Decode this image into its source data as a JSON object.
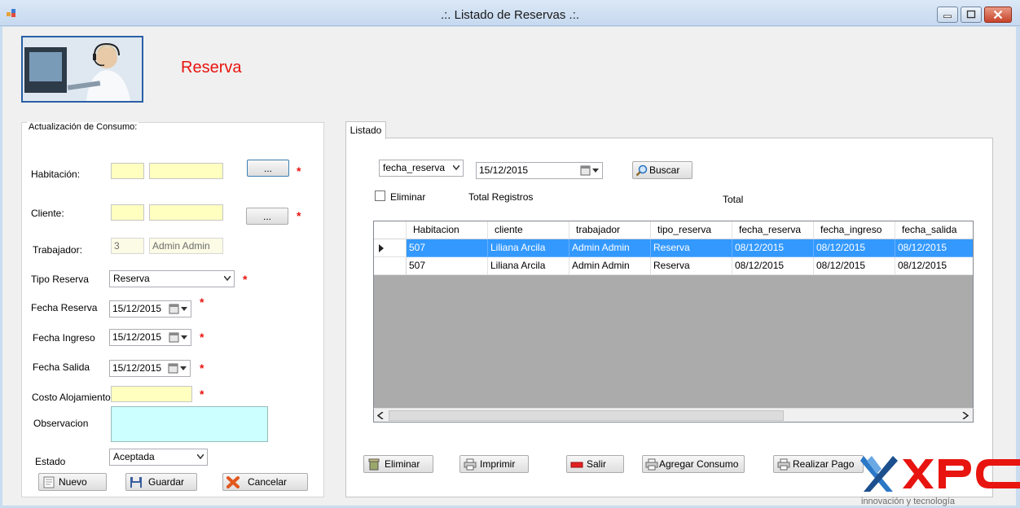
{
  "window": {
    "title": ".:. Listado de Reservas .:.",
    "minimize_icon": "minimize-icon",
    "maximize_icon": "maximize-icon",
    "close_icon": "close-icon"
  },
  "header": {
    "title": "Reserva"
  },
  "form": {
    "group_title": "Actualización de Consumo:",
    "habitacion": {
      "label": "Habitación:",
      "id_value": "",
      "name_value": "",
      "browse_label": "..."
    },
    "cliente": {
      "label": "Cliente:",
      "id_value": "",
      "name_value": "",
      "browse_label": "..."
    },
    "trabajador": {
      "label": "Trabajador:",
      "id_value": "3",
      "name_value": "Admin Admin"
    },
    "tipo_reserva": {
      "label": "Tipo Reserva",
      "value": "Reserva"
    },
    "fecha_reserva": {
      "label": "Fecha Reserva",
      "value": "15/12/2015"
    },
    "fecha_ingreso": {
      "label": "Fecha Ingreso",
      "value": "15/12/2015"
    },
    "fecha_salida": {
      "label": "Fecha Salida",
      "value": "15/12/2015"
    },
    "costo": {
      "label": "Costo Alojamiento",
      "value": ""
    },
    "observacion": {
      "label": "Observacion",
      "value": ""
    },
    "estado": {
      "label": "Estado",
      "value": "Aceptada"
    },
    "required_mark": "*",
    "buttons": {
      "nuevo": "Nuevo",
      "guardar": "Guardar",
      "cancelar": "Cancelar"
    }
  },
  "listado": {
    "tab_label": "Listado",
    "filter_field": "fecha_reserva",
    "filter_date": "15/12/2015",
    "search_label": "Buscar",
    "eliminar_label": "Eliminar",
    "total_registros_label": "Total Registros",
    "total_label": "Total",
    "grid": {
      "columns": [
        "Habitacion",
        "cliente",
        "trabajador",
        "tipo_reserva",
        "fecha_reserva",
        "fecha_ingreso",
        "fecha_salida"
      ],
      "rows": [
        [
          "507",
          "Liliana Arcila",
          "Admin Admin",
          "Reserva",
          "08/12/2015",
          "08/12/2015",
          "08/12/2015"
        ],
        [
          "507",
          "Liliana Arcila",
          "Admin Admin",
          "Reserva",
          "08/12/2015",
          "08/12/2015",
          "08/12/2015"
        ]
      ],
      "selected_row": 0
    },
    "actions": {
      "eliminar": "Eliminar",
      "imprimir": "Imprimir",
      "salir": "Salir",
      "agregar_consumo": "Agregar Consumo",
      "realizar_pago": "Realizar Pago"
    }
  },
  "logo": {
    "tagline": "innovación y tecnología"
  }
}
